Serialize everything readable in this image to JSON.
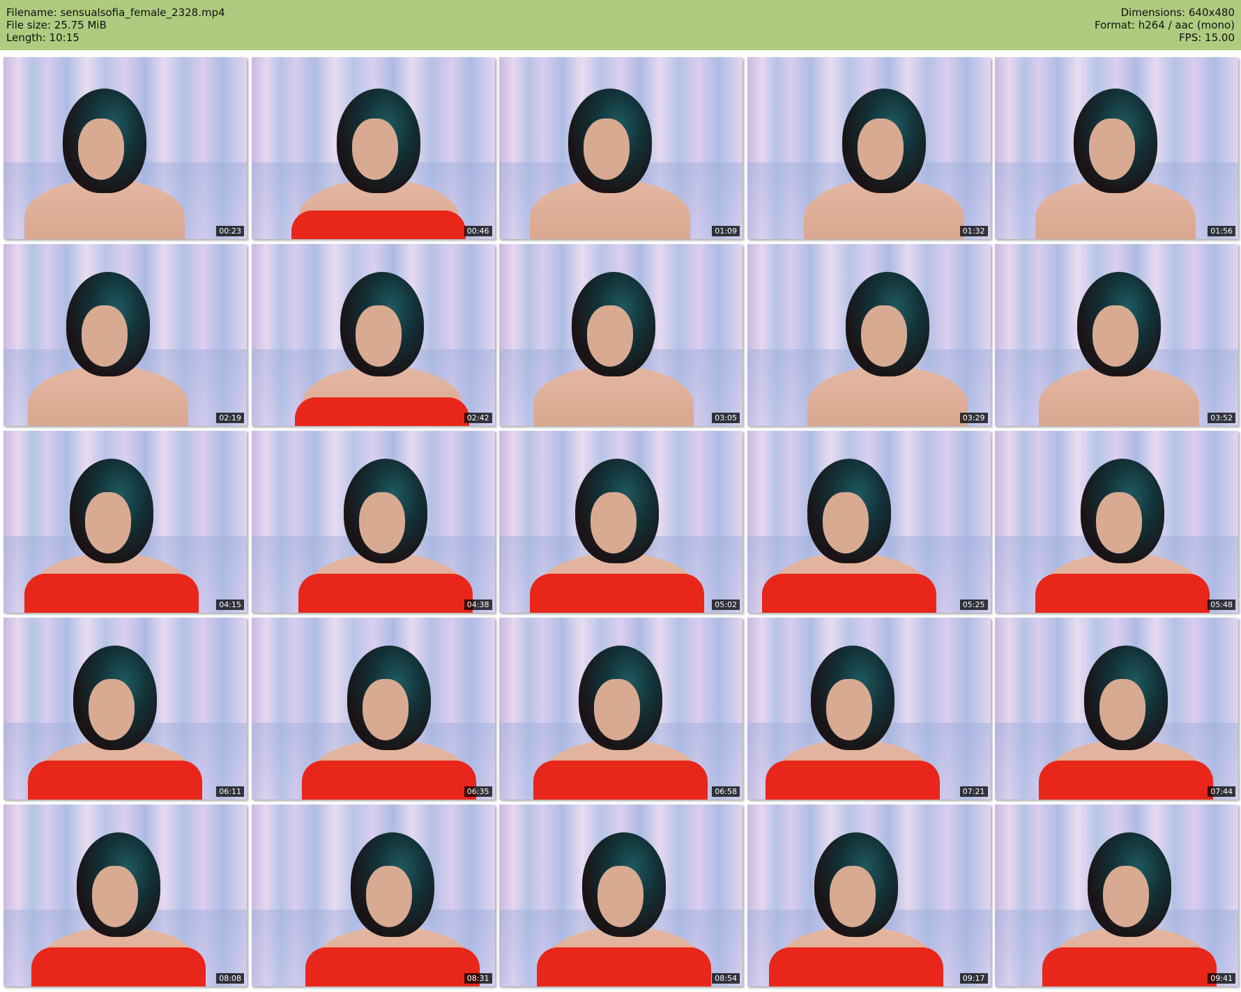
{
  "header": {
    "filename_line": "Filename: sensualsofia_female_2328.mp4",
    "filesize_line": "File size: 25.75 MiB",
    "length_line": "Length: 10:15",
    "dimensions_line": "Dimensions: 640x480",
    "format_line": "Format: h264 / aac (mono)",
    "fps_line": "FPS: 15.00",
    "background_color": "#aecb7f"
  },
  "thumbnails": [
    {
      "timestamp": "00:23",
      "dress": false
    },
    {
      "timestamp": "00:46",
      "dress": true
    },
    {
      "timestamp": "01:09",
      "dress": false
    },
    {
      "timestamp": "01:32",
      "dress": false
    },
    {
      "timestamp": "01:56",
      "dress": false
    },
    {
      "timestamp": "02:19",
      "dress": false
    },
    {
      "timestamp": "02:42",
      "dress": true
    },
    {
      "timestamp": "03:05",
      "dress": false
    },
    {
      "timestamp": "03:29",
      "dress": false
    },
    {
      "timestamp": "03:52",
      "dress": false
    },
    {
      "timestamp": "04:15",
      "dress": true
    },
    {
      "timestamp": "04:38",
      "dress": true
    },
    {
      "timestamp": "05:02",
      "dress": true
    },
    {
      "timestamp": "05:25",
      "dress": true
    },
    {
      "timestamp": "05:48",
      "dress": true
    },
    {
      "timestamp": "06:11",
      "dress": true
    },
    {
      "timestamp": "06:35",
      "dress": true
    },
    {
      "timestamp": "06:58",
      "dress": true
    },
    {
      "timestamp": "07:21",
      "dress": true
    },
    {
      "timestamp": "07:44",
      "dress": true
    },
    {
      "timestamp": "08:08",
      "dress": true
    },
    {
      "timestamp": "08:31",
      "dress": true
    },
    {
      "timestamp": "08:54",
      "dress": true
    },
    {
      "timestamp": "09:17",
      "dress": true
    },
    {
      "timestamp": "09:41",
      "dress": true
    }
  ],
  "colors": {
    "dress": "#e8261a",
    "hair_highlight": "#1e5a60"
  }
}
